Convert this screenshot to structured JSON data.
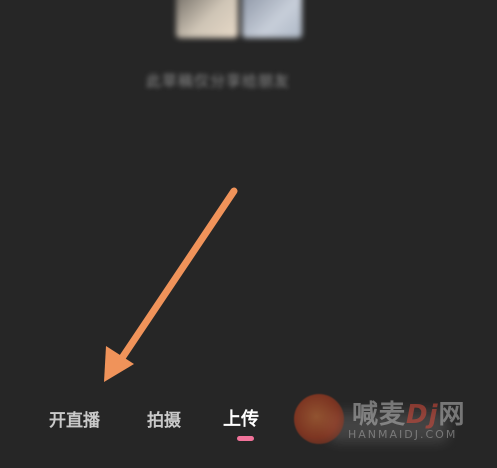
{
  "header": {
    "blurred_caption": "此草稿仅分享给朋友"
  },
  "mode_bar": {
    "tabs": [
      {
        "label": "开直播",
        "selected": false
      },
      {
        "label": "拍摄",
        "selected": false
      },
      {
        "label": "上传",
        "selected": true
      }
    ],
    "indicator_color": "#f1739a"
  },
  "annotation": {
    "arrow_color": "#f0935a",
    "icon": "arrow-icon"
  },
  "watermark": {
    "text_main": "喊麦",
    "text_brand": "Dj",
    "text_suffix": "网",
    "text_sub": "HANMAIDJ.COM",
    "icon": "watermark-logo-icon"
  },
  "colors": {
    "background": "#262626",
    "tab_text": "#c9c9c9",
    "tab_active_text": "#ffffff"
  }
}
